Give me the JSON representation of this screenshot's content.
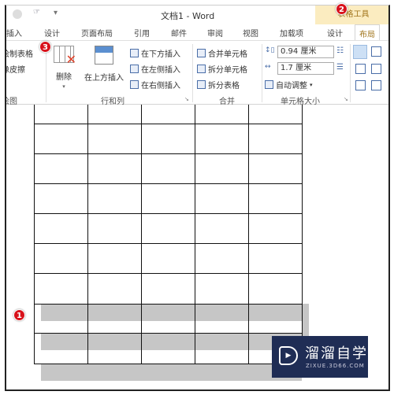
{
  "window": {
    "title": "文档1 - Word",
    "context_tab_group": "表格工具"
  },
  "tabs": [
    {
      "label": "插入"
    },
    {
      "label": "设计"
    },
    {
      "label": "页面布局"
    },
    {
      "label": "引用"
    },
    {
      "label": "邮件"
    },
    {
      "label": "审阅"
    },
    {
      "label": "视图"
    },
    {
      "label": "加载项"
    },
    {
      "label": "设计"
    },
    {
      "label": "布局",
      "active": true
    }
  ],
  "ribbon": {
    "draw": {
      "items": [
        "绘制表格",
        "橡皮擦"
      ],
      "group": "绘图"
    },
    "rows_cols": {
      "delete": "删除",
      "insert_above": "在上方插入",
      "insert_below": "在下方插入",
      "insert_left": "在左侧插入",
      "insert_right": "在右侧插入",
      "group": "行和列"
    },
    "merge": {
      "merge_cells": "合并单元格",
      "split_cells": "拆分单元格",
      "split_table": "拆分表格",
      "group": "合并"
    },
    "cell_size": {
      "height": "0.94 厘米",
      "width": "1.7 厘米",
      "autofit": "自动调整",
      "group": "单元格大小"
    }
  },
  "badges": [
    "1",
    "2",
    "3"
  ],
  "table": {
    "columns": 5,
    "rows": 9,
    "selected_rows": [
      7,
      8,
      9
    ]
  },
  "watermark": {
    "name": "溜溜自学",
    "url": "ZIXUE.3D66.COM"
  },
  "colors": {
    "badge": "#d8121b",
    "context_tab": "#fbecc0",
    "selection": "#c6c6c6",
    "watermark_bg": "#1f2d55"
  }
}
